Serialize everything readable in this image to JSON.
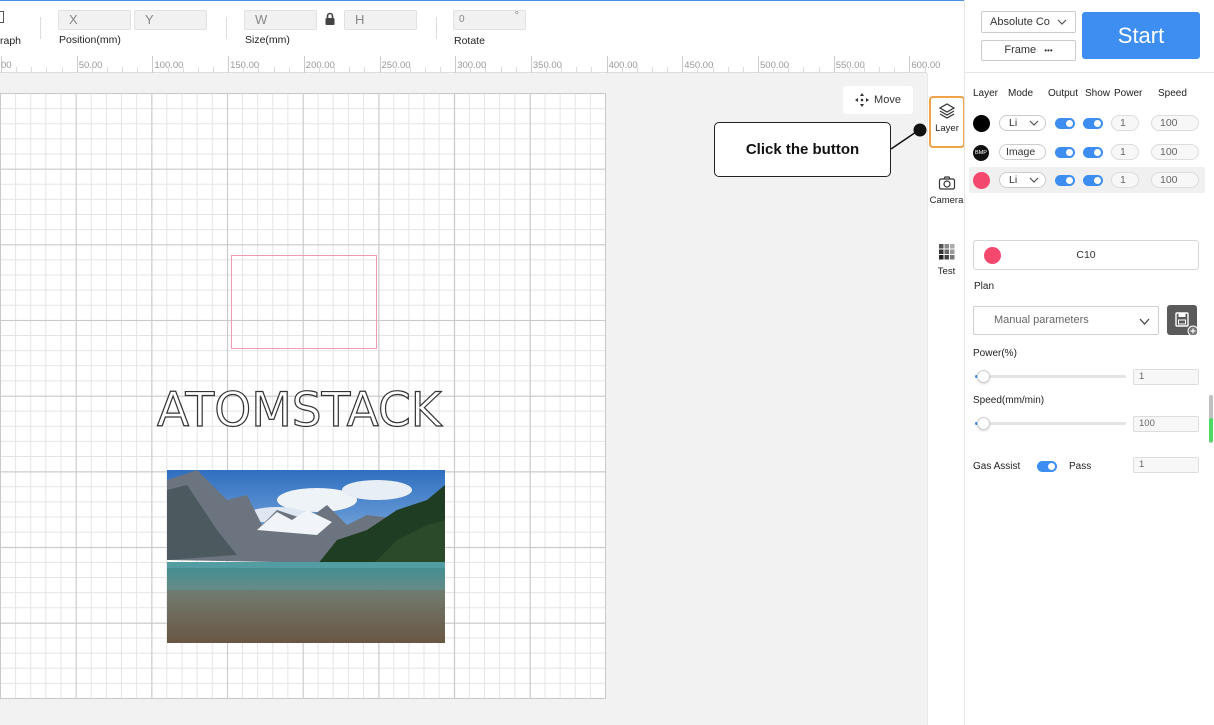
{
  "toolbar": {
    "photograph_label": "raph",
    "position_label": "Position(mm)",
    "x_placeholder": "X",
    "y_placeholder": "Y",
    "size_label": "Size(mm)",
    "w_placeholder": "W",
    "h_placeholder": "H",
    "rotate_label": "Rotate",
    "rotate_value": "0",
    "rotate_unit": "°"
  },
  "ruler": {
    "labels": [
      "00",
      "50.00",
      "100.00",
      "150.00",
      "200.00",
      "250.00",
      "300.00",
      "350.00",
      "400.00",
      "450.00",
      "500.00",
      "550.00",
      "600.00"
    ]
  },
  "canvas": {
    "move_label": "Move",
    "design_text": "ATOMSTACK",
    "callout_text": "Click the button"
  },
  "tools": {
    "layer_label": "Layer",
    "camera_label": "Camera",
    "test_label": "Test"
  },
  "panel": {
    "coordinate_mode": "Absolute Co",
    "frame_label": "Frame",
    "frame_more": "•••",
    "start_label": "Start",
    "headers": {
      "layer": "Layer",
      "mode": "Mode",
      "output": "Output",
      "show": "Show",
      "power": "Power",
      "speed": "Speed"
    },
    "layers": [
      {
        "color": "#000000",
        "mode": "Li",
        "power": "1",
        "speed": "100"
      },
      {
        "badge": "BMP",
        "mode": "Image",
        "power": "1",
        "speed": "100"
      },
      {
        "color": "#f5486f",
        "mode": "Li",
        "power": "1",
        "speed": "100"
      }
    ],
    "selected_color": "#f5486f",
    "selected_layer_name": "C10",
    "plan_label": "Plan",
    "plan_value": "Manual parameters",
    "power_label": "Power(%)",
    "power_value": "1",
    "speed_label": "Speed(mm/min)",
    "speed_value": "100",
    "gas_assist_label": "Gas Assist",
    "pass_label": "Pass",
    "pass_value": "1"
  },
  "colors": {
    "accent": "#3d8ef0",
    "highlight": "#f0a347",
    "pink": "#f5486f"
  }
}
